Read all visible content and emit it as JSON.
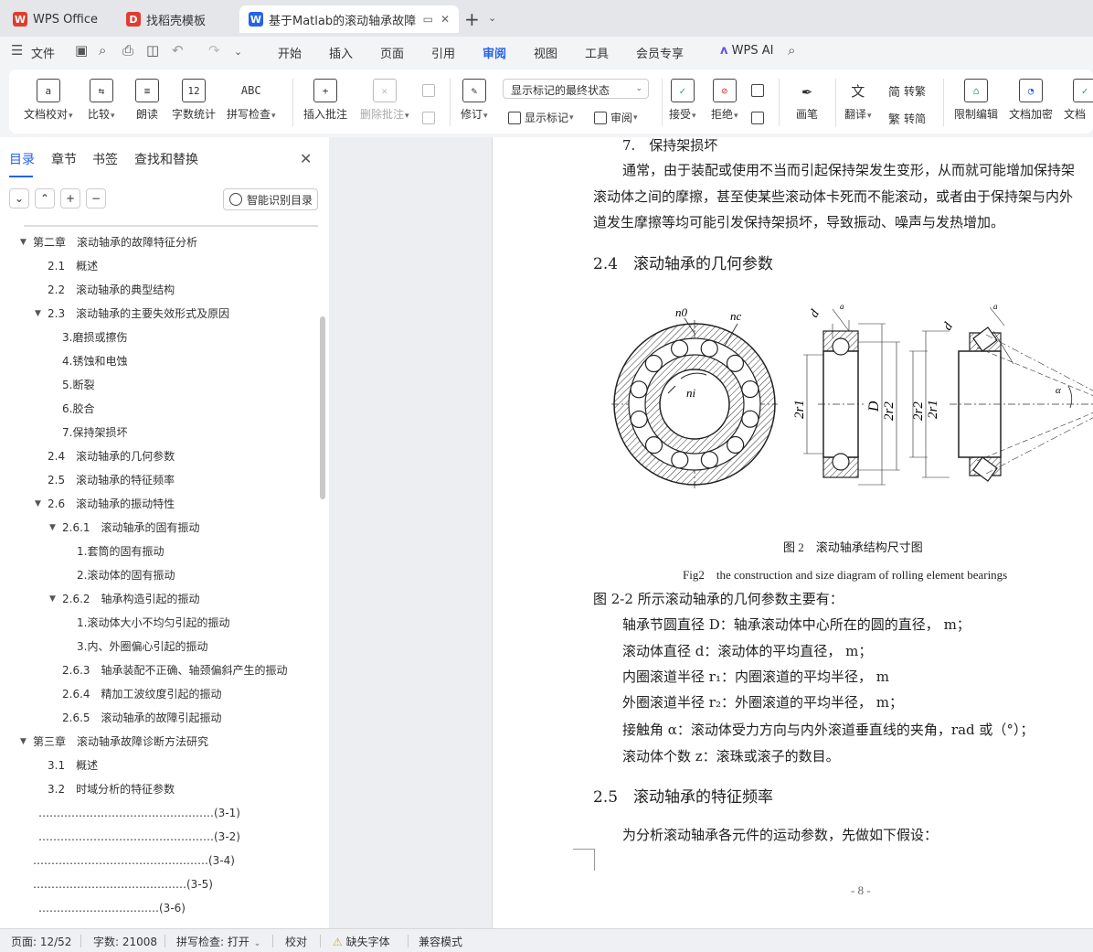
{
  "tabs": [
    {
      "label": "WPS Office",
      "logo": "W",
      "color": "#e03c31",
      "active": false
    },
    {
      "label": "找稻壳模板",
      "logo": "D",
      "color": "#e03c31",
      "active": false
    },
    {
      "label": "基于Matlab的滚动轴承故障诊",
      "logo": "W",
      "color": "#2462e8",
      "active": true
    }
  ],
  "menu": {
    "file": "文件",
    "items": [
      "开始",
      "插入",
      "页面",
      "引用",
      "审阅",
      "视图",
      "工具",
      "会员专享"
    ],
    "active": "审阅",
    "wps_ai": "WPS AI"
  },
  "ribbon": {
    "doc_proof": "文档校对",
    "compare": "比较",
    "read_aloud": "朗读",
    "word_count": "字数统计",
    "spell_check": "拼写检查",
    "insert_comment": "插入批注",
    "delete_comment": "删除批注",
    "revise": "修订",
    "markup_mode": "显示标记的最终状态",
    "show_markup": "显示标记",
    "review": "审阅",
    "accept": "接受",
    "reject": "拒绝",
    "pen": "画笔",
    "translate": "翻译",
    "to_traditional": "转繁",
    "to_simplified": "转简",
    "restrict_edit": "限制编辑",
    "doc_encrypt": "文档加密",
    "doc_more": "文档"
  },
  "nav": {
    "tabs": [
      "目录",
      "章节",
      "书签",
      "查找和替换"
    ],
    "active_tab": "目录",
    "smart_toc": "智能识别目录",
    "toc": [
      {
        "level": 0,
        "expanded": true,
        "text": "第二章　滚动轴承的故障特征分析"
      },
      {
        "level": 1,
        "text": "2.1　概述"
      },
      {
        "level": 1,
        "text": "2.2　滚动轴承的典型结构"
      },
      {
        "level": 1,
        "expanded": true,
        "text": "2.3　滚动轴承的主要失效形式及原因"
      },
      {
        "level": 2,
        "text": "3.磨损或擦伤"
      },
      {
        "level": 2,
        "text": "4.锈蚀和电蚀"
      },
      {
        "level": 2,
        "text": "5.断裂"
      },
      {
        "level": 2,
        "text": "6.胶合"
      },
      {
        "level": 2,
        "text": "7.保持架损坏"
      },
      {
        "level": 1,
        "text": "2.4　滚动轴承的几何参数"
      },
      {
        "level": 1,
        "text": "2.5　滚动轴承的特征频率"
      },
      {
        "level": 1,
        "expanded": true,
        "text": "2.6　滚动轴承的振动特性"
      },
      {
        "level": 2,
        "expanded": true,
        "text": "2.6.1　滚动轴承的固有振动"
      },
      {
        "level": 3,
        "text": "1.套筒的固有振动"
      },
      {
        "level": 3,
        "text": "2.滚动体的固有振动"
      },
      {
        "level": 2,
        "expanded": true,
        "text": "2.6.2　轴承构造引起的振动"
      },
      {
        "level": 3,
        "text": "1.滚动体大小不均匀引起的振动"
      },
      {
        "level": 3,
        "text": "3.内、外圈偏心引起的振动"
      },
      {
        "level": 2,
        "text": "2.6.3　轴承装配不正确、轴颈偏斜产生的振动"
      },
      {
        "level": 2,
        "text": "2.6.4　精加工波纹度引起的振动"
      },
      {
        "level": 2,
        "text": "2.6.5　滚动轴承的故障引起振动"
      },
      {
        "level": 0,
        "expanded": true,
        "text": "第三章　滚动轴承故障诊断方法研究"
      },
      {
        "level": 1,
        "text": "3.1　概述"
      },
      {
        "level": 1,
        "text": "3.2　时域分析的特征参数"
      },
      {
        "level": 4,
        "indent": 42,
        "text": "…………………………………………(3-1)"
      },
      {
        "level": 4,
        "indent": 42,
        "text": "…………………………………………(3-2)"
      },
      {
        "level": 4,
        "indent": 36,
        "text": "…………………………………………(3-4)"
      },
      {
        "level": 4,
        "indent": 36,
        "text": "……………………………………(3-5)"
      },
      {
        "level": 4,
        "indent": 42,
        "text": "……………………………(3-6)"
      }
    ]
  },
  "doc": {
    "item7": "7.　保持架损坏",
    "para1_l1": "通常，由于装配或使用不当而引起保持架发生变形，从而就可能增加保持架",
    "para1_l2": "滚动体之间的摩擦，甚至使某些滚动体卡死而不能滚动，或者由于保持架与内外",
    "para1_l3": "道发生摩擦等均可能引发保持架损坏，导致振动、噪声与发热增加。",
    "h24": "2.4　滚动轴承的几何参数",
    "fig_caption_cn": "图 2　滚动轴承结构尺寸图",
    "fig_caption_en": "Fig2　the construction and size diagram of rolling element bearings",
    "fig_labels": {
      "n0": "n0",
      "nc": "nc",
      "ni": "ni",
      "d": "d",
      "a": "a",
      "2r1": "2r1",
      "D": "D",
      "2r2": "2r2",
      "alpha": "α"
    },
    "intro": "图 2-2 所示滚动轴承的几何参数主要有：",
    "param1": "轴承节圆直径 D：轴承滚动体中心所在的圆的直径， m；",
    "param2": "滚动体直径 d：滚动体的平均直径， m；",
    "param3": "内圈滚道半径 r₁：内圈滚道的平均半径， m",
    "param4": "外圈滚道半径 r₂：外圈滚道的平均半径， m；",
    "param5": "接触角 α：滚动体受力方向与内外滚道垂直线的夹角，rad 或（°）；",
    "param6": "滚动体个数 z：滚珠或滚子的数目。",
    "h25": "2.5　滚动轴承的特征频率",
    "para_last": "为分析滚动轴承各元件的运动参数，先做如下假设：",
    "page_number": "- 8 -"
  },
  "status": {
    "page": "页面: 12/52",
    "words": "字数: 21008",
    "spell": "拼写检查: 打开",
    "proof": "校对",
    "missing_font": "缺失字体",
    "compat": "兼容模式"
  }
}
